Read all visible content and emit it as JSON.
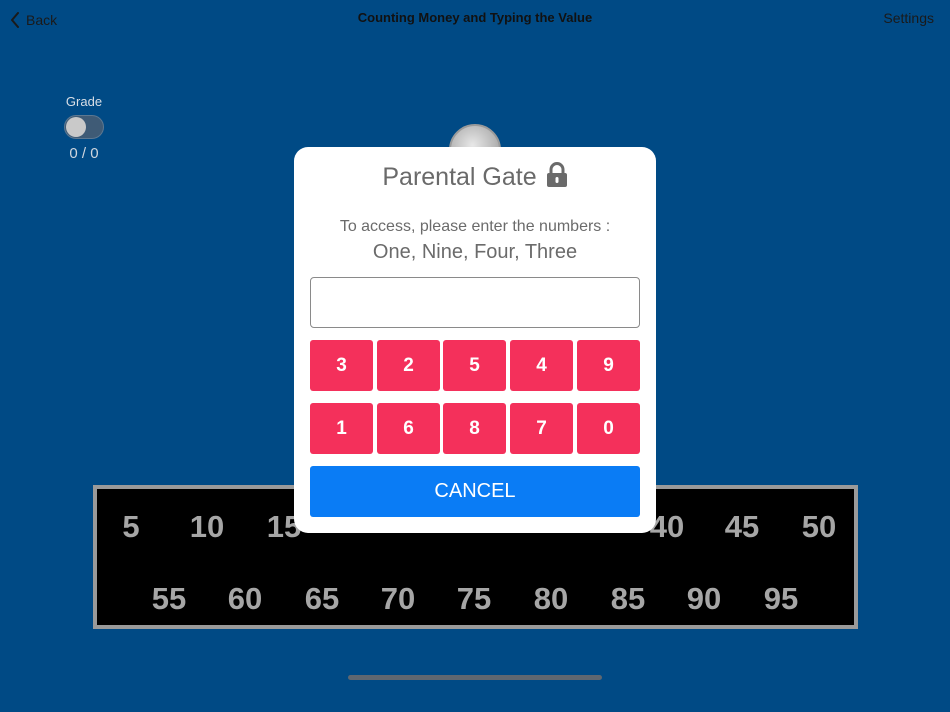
{
  "nav": {
    "back_label": "Back",
    "title": "Counting Money and Typing the Value",
    "settings_label": "Settings"
  },
  "grade": {
    "label": "Grade",
    "enabled": false,
    "score": "0 / 0"
  },
  "board": {
    "numbers": [
      "5",
      "10",
      "15",
      "40",
      "45",
      "50",
      "55",
      "60",
      "65",
      "70",
      "75",
      "80",
      "85",
      "90",
      "95"
    ]
  },
  "modal": {
    "title": "Parental Gate",
    "lock_icon": "lock-icon",
    "instruction": "To access, please enter the numbers :",
    "sequence": "One, Nine, Four, Three",
    "input_value": "",
    "keys_row1": [
      "3",
      "2",
      "5",
      "4",
      "9"
    ],
    "keys_row2": [
      "1",
      "6",
      "8",
      "7",
      "0"
    ],
    "cancel_label": "CANCEL"
  },
  "colors": {
    "background": "#004a85",
    "key": "#f4305b",
    "cancel": "#0a7cf5",
    "board": "#000000",
    "board_text": "#a6a6a6"
  }
}
